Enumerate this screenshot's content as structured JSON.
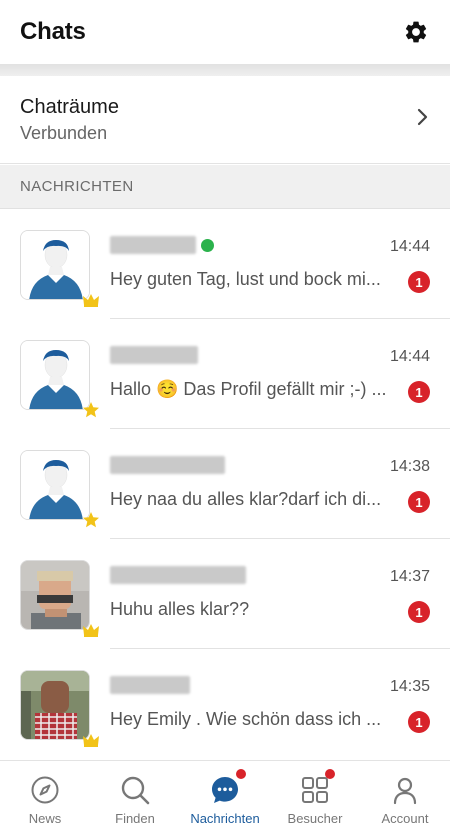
{
  "header": {
    "title": "Chats",
    "settings_icon": "gear-icon"
  },
  "rooms": {
    "title": "Chaträume",
    "subtitle": "Verbunden",
    "chevron_icon": "chevron-right-icon"
  },
  "section": {
    "label": "NACHRICHTEN"
  },
  "colors": {
    "accent": "#1d5c9c",
    "unread": "#d8232a",
    "online": "#2bb24c",
    "crown": "#f2c318"
  },
  "chats": [
    {
      "name_obscured": true,
      "avatar": "default-user-avatar",
      "badge": "crown-icon",
      "online": true,
      "time": "14:44",
      "message": "Hey guten Tag, lust und bock mi...",
      "unread": "1"
    },
    {
      "name_obscured": true,
      "avatar": "default-user-avatar",
      "badge": "star-icon",
      "online": false,
      "time": "14:44",
      "message": "Hallo ☺️ Das Profil gefällt mir ;-) ...",
      "unread": "1"
    },
    {
      "name_obscured": true,
      "avatar": "default-user-avatar",
      "badge": "star-icon",
      "online": false,
      "time": "14:38",
      "message": "Hey naa du alles klar?darf ich di...",
      "unread": "1"
    },
    {
      "name_obscured": true,
      "avatar": "photo-avatar",
      "badge": "crown-icon",
      "online": false,
      "time": "14:37",
      "message": "Huhu alles klar??",
      "unread": "1"
    },
    {
      "name_obscured": true,
      "avatar": "photo-avatar",
      "badge": "crown-icon",
      "online": false,
      "time": "14:35",
      "message": "Hey Emily . Wie schön dass ich ...",
      "unread": "1"
    }
  ],
  "nav": [
    {
      "label": "News",
      "icon": "compass-icon",
      "active": false,
      "dot": false
    },
    {
      "label": "Finden",
      "icon": "search-icon",
      "active": false,
      "dot": false
    },
    {
      "label": "Nachrichten",
      "icon": "chat-bubble-icon",
      "active": true,
      "dot": true
    },
    {
      "label": "Besucher",
      "icon": "grid-icon",
      "active": false,
      "dot": true
    },
    {
      "label": "Account",
      "icon": "person-icon",
      "active": false,
      "dot": false
    }
  ]
}
